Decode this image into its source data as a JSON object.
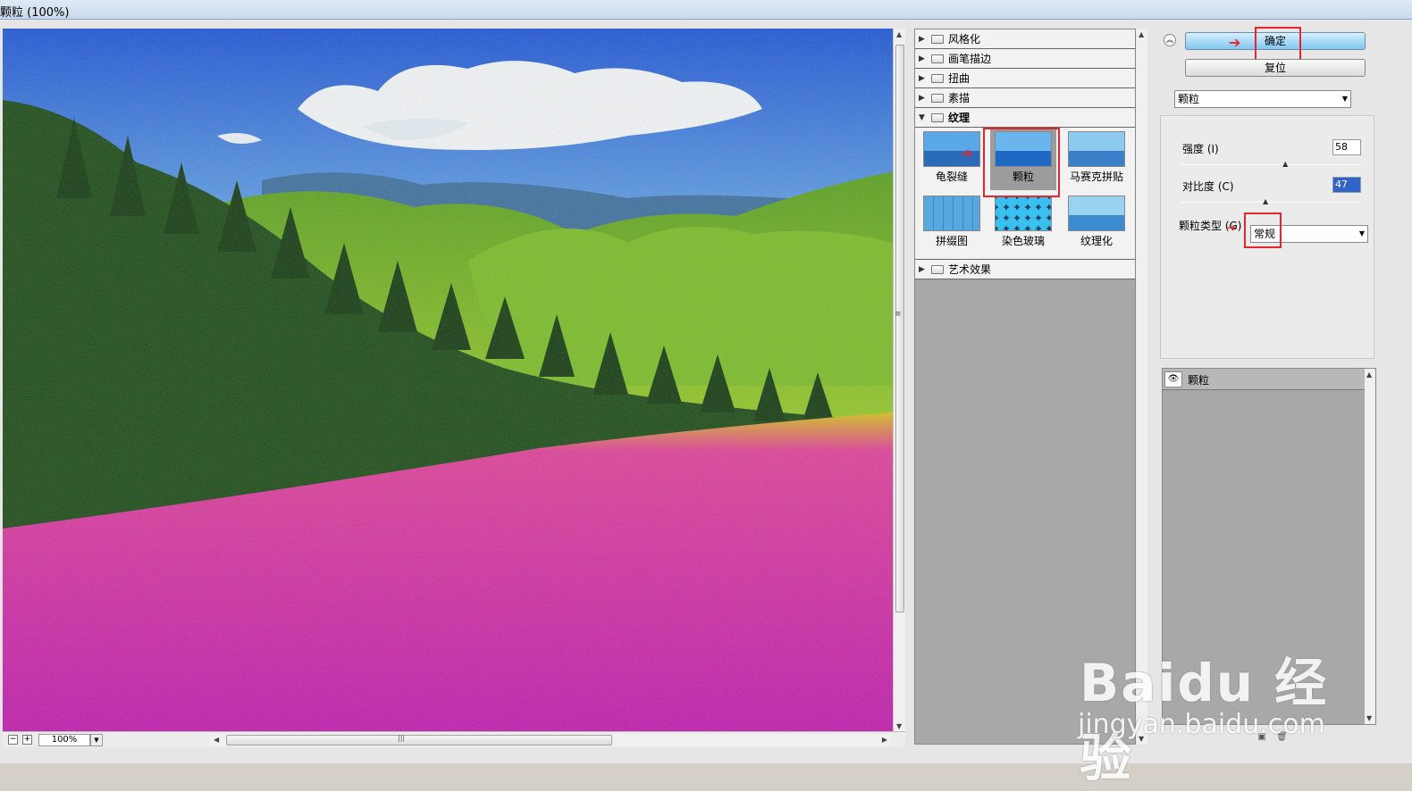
{
  "window": {
    "title": "颗粒 (100%)"
  },
  "preview": {
    "zoom": "100%"
  },
  "gallery": {
    "categories_top": [
      "风格化",
      "画笔描边",
      "扭曲",
      "素描"
    ],
    "open_category": "纹理",
    "thumbs": [
      "龟裂缝",
      "颗粒",
      "马赛克拼贴",
      "拼缀图",
      "染色玻璃",
      "纹理化"
    ],
    "selected_thumb": "颗粒",
    "categories_bottom": [
      "艺术效果"
    ]
  },
  "controls": {
    "ok_label": "确定",
    "reset_label": "复位",
    "filter_select": "颗粒",
    "intensity_label": "强度 (I)",
    "intensity_value": "58",
    "intensity_level": 0.58,
    "contrast_label": "对比度 (C)",
    "contrast_value": "47",
    "contrast_level": 0.47,
    "grain_type_label": "颗粒类型 (G)",
    "grain_type_value": "常规"
  },
  "layers": {
    "item": "颗粒"
  },
  "watermark": {
    "brand": "Baidu 经验",
    "url": "jingyan.baidu.com"
  },
  "colors": {
    "annotation_red": "#e8262a",
    "ok_button": "#7fc6ef"
  }
}
